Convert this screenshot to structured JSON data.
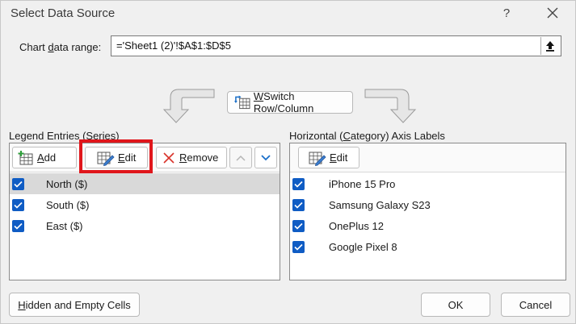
{
  "window": {
    "title": "Select Data Source",
    "help_label": "?"
  },
  "range": {
    "label_pre": "Chart ",
    "label_accel": "d",
    "label_post": "ata range:",
    "value": "='Sheet1 (2)'!$A$1:$D$5"
  },
  "switch": {
    "accel": "W",
    "label_rest": "Switch Row/Column"
  },
  "legend": {
    "title": "Legend Entries (Series)",
    "add_accel": "A",
    "add_rest": "dd",
    "edit_accel": "E",
    "edit_rest": "dit",
    "remove_accel": "R",
    "remove_rest": "emove",
    "series": [
      {
        "label": "North ($)",
        "checked": true,
        "selected": true
      },
      {
        "label": "South ($)",
        "checked": true,
        "selected": false
      },
      {
        "label": "East ($)",
        "checked": true,
        "selected": false
      }
    ]
  },
  "axis": {
    "title_pre": "Horizontal (",
    "title_accel": "C",
    "title_post": "ategory) Axis Labels",
    "edit_accel": "E",
    "edit_rest": "dit",
    "categories": [
      {
        "label": "iPhone 15 Pro",
        "checked": true
      },
      {
        "label": "Samsung Galaxy S23",
        "checked": true
      },
      {
        "label": "OnePlus 12",
        "checked": true
      },
      {
        "label": "Google Pixel 8",
        "checked": true
      }
    ]
  },
  "footer": {
    "hidden_accel": "H",
    "hidden_rest": "idden and Empty Cells",
    "ok_label": "OK",
    "cancel_label": "Cancel"
  },
  "colors": {
    "checkbox": "#0f5cc4",
    "highlight": "#e0161b",
    "remove_x": "#d9342b",
    "arrow_buttons": "#1a6fc9"
  }
}
